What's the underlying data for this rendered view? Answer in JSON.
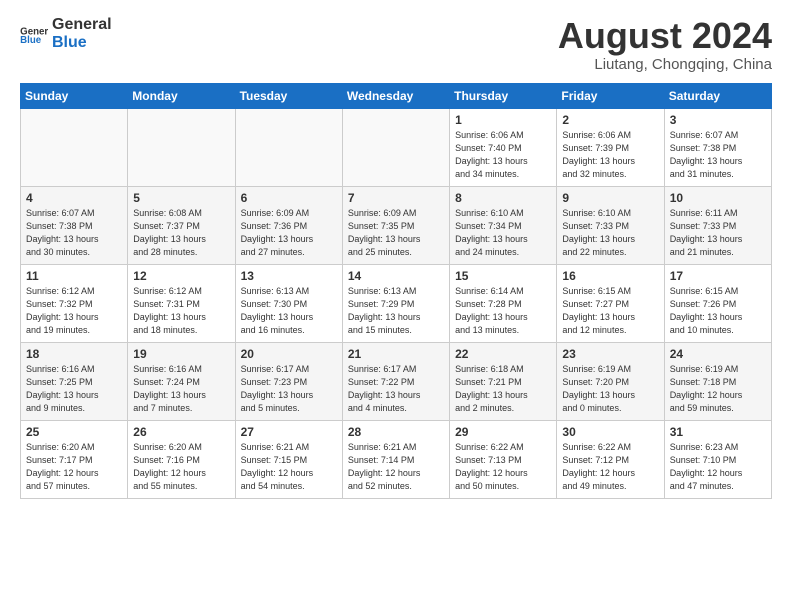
{
  "header": {
    "logo_general": "General",
    "logo_blue": "Blue",
    "month_title": "August 2024",
    "location": "Liutang, Chongqing, China"
  },
  "weekdays": [
    "Sunday",
    "Monday",
    "Tuesday",
    "Wednesday",
    "Thursday",
    "Friday",
    "Saturday"
  ],
  "weeks": [
    [
      {
        "day": "",
        "info": ""
      },
      {
        "day": "",
        "info": ""
      },
      {
        "day": "",
        "info": ""
      },
      {
        "day": "",
        "info": ""
      },
      {
        "day": "1",
        "info": "Sunrise: 6:06 AM\nSunset: 7:40 PM\nDaylight: 13 hours\nand 34 minutes."
      },
      {
        "day": "2",
        "info": "Sunrise: 6:06 AM\nSunset: 7:39 PM\nDaylight: 13 hours\nand 32 minutes."
      },
      {
        "day": "3",
        "info": "Sunrise: 6:07 AM\nSunset: 7:38 PM\nDaylight: 13 hours\nand 31 minutes."
      }
    ],
    [
      {
        "day": "4",
        "info": "Sunrise: 6:07 AM\nSunset: 7:38 PM\nDaylight: 13 hours\nand 30 minutes."
      },
      {
        "day": "5",
        "info": "Sunrise: 6:08 AM\nSunset: 7:37 PM\nDaylight: 13 hours\nand 28 minutes."
      },
      {
        "day": "6",
        "info": "Sunrise: 6:09 AM\nSunset: 7:36 PM\nDaylight: 13 hours\nand 27 minutes."
      },
      {
        "day": "7",
        "info": "Sunrise: 6:09 AM\nSunset: 7:35 PM\nDaylight: 13 hours\nand 25 minutes."
      },
      {
        "day": "8",
        "info": "Sunrise: 6:10 AM\nSunset: 7:34 PM\nDaylight: 13 hours\nand 24 minutes."
      },
      {
        "day": "9",
        "info": "Sunrise: 6:10 AM\nSunset: 7:33 PM\nDaylight: 13 hours\nand 22 minutes."
      },
      {
        "day": "10",
        "info": "Sunrise: 6:11 AM\nSunset: 7:33 PM\nDaylight: 13 hours\nand 21 minutes."
      }
    ],
    [
      {
        "day": "11",
        "info": "Sunrise: 6:12 AM\nSunset: 7:32 PM\nDaylight: 13 hours\nand 19 minutes."
      },
      {
        "day": "12",
        "info": "Sunrise: 6:12 AM\nSunset: 7:31 PM\nDaylight: 13 hours\nand 18 minutes."
      },
      {
        "day": "13",
        "info": "Sunrise: 6:13 AM\nSunset: 7:30 PM\nDaylight: 13 hours\nand 16 minutes."
      },
      {
        "day": "14",
        "info": "Sunrise: 6:13 AM\nSunset: 7:29 PM\nDaylight: 13 hours\nand 15 minutes."
      },
      {
        "day": "15",
        "info": "Sunrise: 6:14 AM\nSunset: 7:28 PM\nDaylight: 13 hours\nand 13 minutes."
      },
      {
        "day": "16",
        "info": "Sunrise: 6:15 AM\nSunset: 7:27 PM\nDaylight: 13 hours\nand 12 minutes."
      },
      {
        "day": "17",
        "info": "Sunrise: 6:15 AM\nSunset: 7:26 PM\nDaylight: 13 hours\nand 10 minutes."
      }
    ],
    [
      {
        "day": "18",
        "info": "Sunrise: 6:16 AM\nSunset: 7:25 PM\nDaylight: 13 hours\nand 9 minutes."
      },
      {
        "day": "19",
        "info": "Sunrise: 6:16 AM\nSunset: 7:24 PM\nDaylight: 13 hours\nand 7 minutes."
      },
      {
        "day": "20",
        "info": "Sunrise: 6:17 AM\nSunset: 7:23 PM\nDaylight: 13 hours\nand 5 minutes."
      },
      {
        "day": "21",
        "info": "Sunrise: 6:17 AM\nSunset: 7:22 PM\nDaylight: 13 hours\nand 4 minutes."
      },
      {
        "day": "22",
        "info": "Sunrise: 6:18 AM\nSunset: 7:21 PM\nDaylight: 13 hours\nand 2 minutes."
      },
      {
        "day": "23",
        "info": "Sunrise: 6:19 AM\nSunset: 7:20 PM\nDaylight: 13 hours\nand 0 minutes."
      },
      {
        "day": "24",
        "info": "Sunrise: 6:19 AM\nSunset: 7:18 PM\nDaylight: 12 hours\nand 59 minutes."
      }
    ],
    [
      {
        "day": "25",
        "info": "Sunrise: 6:20 AM\nSunset: 7:17 PM\nDaylight: 12 hours\nand 57 minutes."
      },
      {
        "day": "26",
        "info": "Sunrise: 6:20 AM\nSunset: 7:16 PM\nDaylight: 12 hours\nand 55 minutes."
      },
      {
        "day": "27",
        "info": "Sunrise: 6:21 AM\nSunset: 7:15 PM\nDaylight: 12 hours\nand 54 minutes."
      },
      {
        "day": "28",
        "info": "Sunrise: 6:21 AM\nSunset: 7:14 PM\nDaylight: 12 hours\nand 52 minutes."
      },
      {
        "day": "29",
        "info": "Sunrise: 6:22 AM\nSunset: 7:13 PM\nDaylight: 12 hours\nand 50 minutes."
      },
      {
        "day": "30",
        "info": "Sunrise: 6:22 AM\nSunset: 7:12 PM\nDaylight: 12 hours\nand 49 minutes."
      },
      {
        "day": "31",
        "info": "Sunrise: 6:23 AM\nSunset: 7:10 PM\nDaylight: 12 hours\nand 47 minutes."
      }
    ]
  ]
}
